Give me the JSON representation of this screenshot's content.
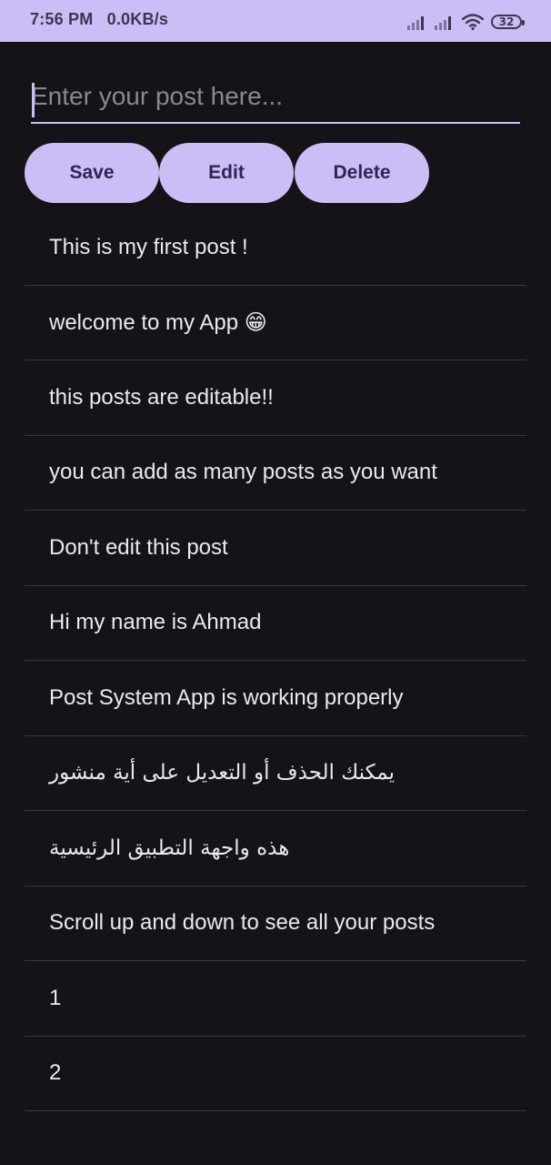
{
  "status_bar": {
    "time": "7:56 PM",
    "speed": "0.0KB/s",
    "battery": "32",
    "icons": [
      "signal-icon",
      "signal-icon",
      "wifi-icon",
      "battery-icon"
    ]
  },
  "composer": {
    "placeholder": "Enter your post here...",
    "value": ""
  },
  "buttons": {
    "save": "Save",
    "edit": "Edit",
    "delete": "Delete"
  },
  "posts": [
    "This is my first post !",
    "welcome to my App 😁",
    "this posts are editable!!",
    "you can add as many posts as you want",
    "Don't edit this post",
    "Hi my name is Ahmad",
    "Post System App is working properly",
    "يمكنك الحذف أو التعديل على أية منشور",
    "هذه واجهة التطبيق الرئيسية",
    "Scroll up and down to see all your posts",
    "1",
    "2"
  ],
  "colors": {
    "background": "#151218",
    "accent": "#cdbdf7",
    "button_text": "#2d2552",
    "text": "#ece7f2",
    "divider": "#3a3540"
  }
}
